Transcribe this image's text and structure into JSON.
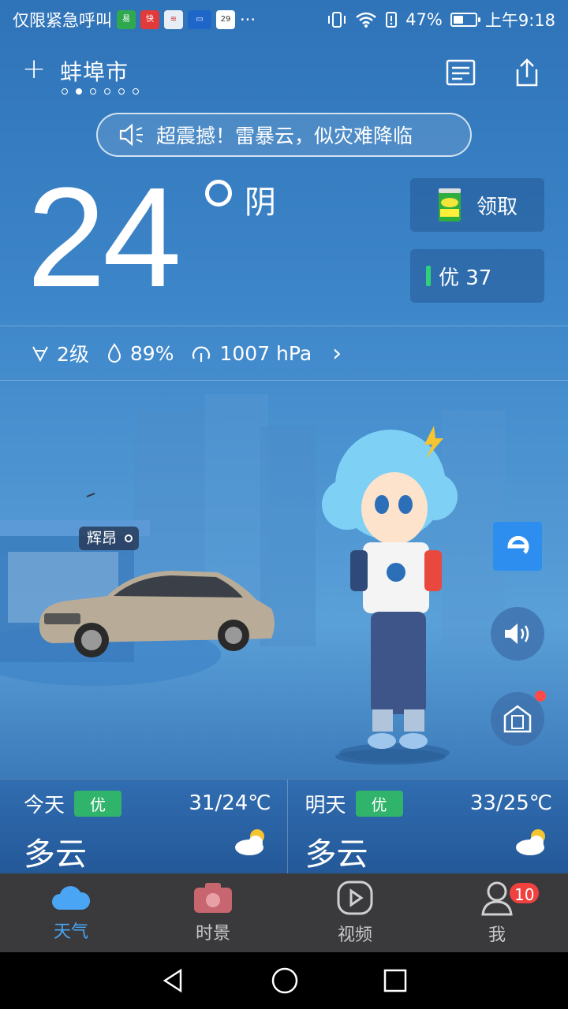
{
  "status_bar": {
    "notification_text": "仅限紧急呼叫",
    "app_icons": [
      "app-green-icon",
      "app-red-icon",
      "app-train-icon",
      "app-car-icon",
      "calendar-icon"
    ],
    "calendar_day": "29",
    "more": "···",
    "battery_percent": "47%",
    "battery_level": 0.47,
    "time": "上午9:18"
  },
  "header": {
    "add_symbol": "+",
    "city": "蚌埠市",
    "page_dots": 6,
    "active_dot": 1
  },
  "alert": {
    "text": "超震撼！雷暴云，似灾难降临"
  },
  "current": {
    "temperature": "24",
    "condition": "阴",
    "gift_label": "领取",
    "aqi_label": "优 37",
    "aqi_color": "#2fd07a"
  },
  "stats": {
    "wind": "2级",
    "humidity": "89%",
    "pressure": "1007 hPa",
    "more_symbol": "›"
  },
  "scene": {
    "car_label": "辉昂"
  },
  "forecast": [
    {
      "day": "今天",
      "aqi": "优",
      "range": "31/24℃",
      "condition": "多云"
    },
    {
      "day": "明天",
      "aqi": "优",
      "range": "33/25℃",
      "condition": "多云"
    }
  ],
  "tabs": [
    {
      "label": "天气",
      "active": true
    },
    {
      "label": "时景",
      "active": false
    },
    {
      "label": "视频",
      "active": false
    },
    {
      "label": "我",
      "active": false,
      "badge": "10"
    }
  ],
  "colors": {
    "accent": "#4aa6f5",
    "aqi_good": "#30b36a",
    "badge_red": "#f0413e"
  }
}
